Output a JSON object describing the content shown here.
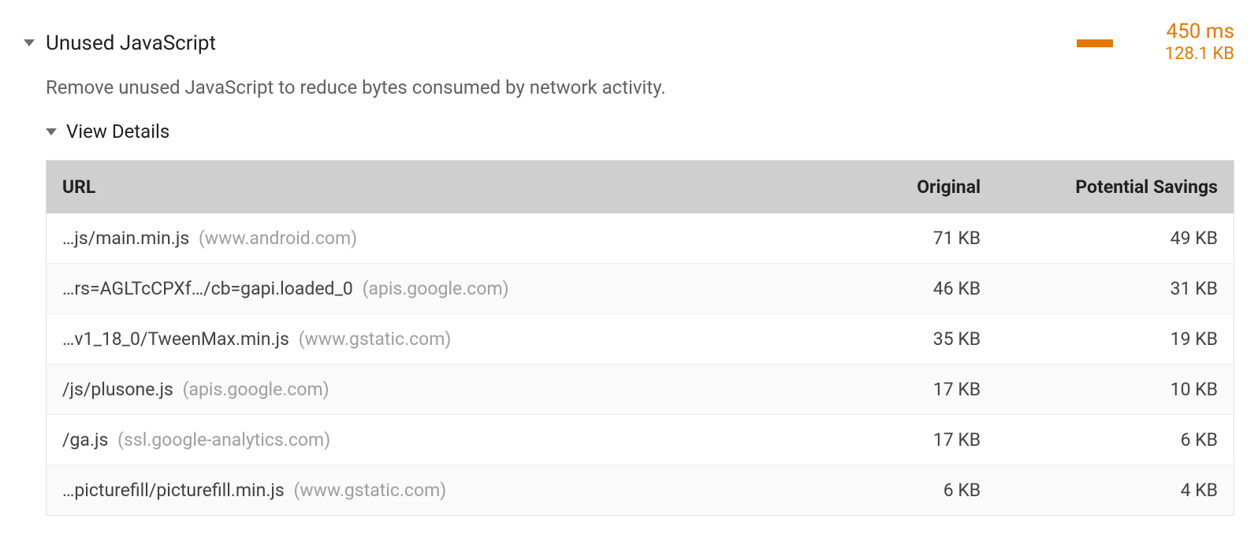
{
  "audit": {
    "title": "Unused JavaScript",
    "time_value": "450 ms",
    "size_value": "128.1 KB",
    "description": "Remove unused JavaScript to reduce bytes consumed by network activity.",
    "details_label": "View Details",
    "accent_color": "#e67700",
    "columns": {
      "url": "URL",
      "original": "Original",
      "savings": "Potential Savings"
    },
    "rows": [
      {
        "path": "…js/main.min.js",
        "host": "www.android.com",
        "original": "71 KB",
        "savings": "49 KB"
      },
      {
        "path": "…rs=AGLTcCPXf…/cb=gapi.loaded_0",
        "host": "apis.google.com",
        "original": "46 KB",
        "savings": "31 KB"
      },
      {
        "path": "…v1_18_0/TweenMax.min.js",
        "host": "www.gstatic.com",
        "original": "35 KB",
        "savings": "19 KB"
      },
      {
        "path": "/js/plusone.js",
        "host": "apis.google.com",
        "original": "17 KB",
        "savings": "10 KB"
      },
      {
        "path": "/ga.js",
        "host": "ssl.google-analytics.com",
        "original": "17 KB",
        "savings": "6 KB"
      },
      {
        "path": "…picturefill/picturefill.min.js",
        "host": "www.gstatic.com",
        "original": "6 KB",
        "savings": "4 KB"
      }
    ]
  }
}
